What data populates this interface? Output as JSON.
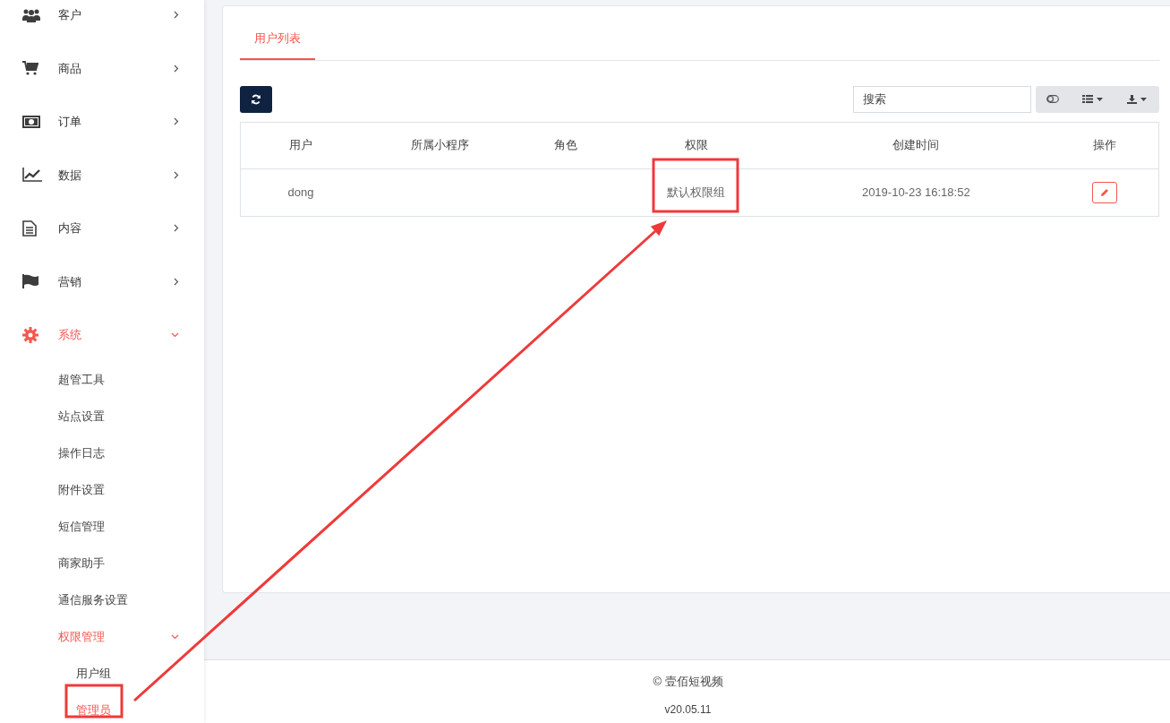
{
  "sidebar": {
    "items": [
      {
        "label": "客户",
        "expanded": false
      },
      {
        "label": "商品",
        "expanded": false
      },
      {
        "label": "订单",
        "expanded": false
      },
      {
        "label": "数据",
        "expanded": false
      },
      {
        "label": "内容",
        "expanded": false
      },
      {
        "label": "营销",
        "expanded": false
      },
      {
        "label": "系统",
        "expanded": true,
        "children": [
          {
            "label": "超管工具",
            "expanded": false
          },
          {
            "label": "站点设置",
            "expanded": false
          },
          {
            "label": "操作日志",
            "expanded": false
          },
          {
            "label": "附件设置",
            "expanded": false
          },
          {
            "label": "短信管理",
            "expanded": false
          },
          {
            "label": "商家助手",
            "expanded": false
          },
          {
            "label": "通信服务设置",
            "expanded": false
          },
          {
            "label": "权限管理",
            "expanded": true,
            "children": [
              {
                "label": "用户组",
                "selected": false
              },
              {
                "label": "管理员",
                "selected": true
              }
            ]
          }
        ]
      }
    ]
  },
  "tabs": [
    {
      "label": "用户列表",
      "selected": true
    }
  ],
  "search": {
    "placeholder": "搜索"
  },
  "table": {
    "columns": [
      "用户",
      "所属小程序",
      "角色",
      "权限",
      "创建时间",
      "操作"
    ],
    "rows": [
      {
        "cells": [
          "dong",
          "",
          "",
          "默认权限组",
          "2019-10-23 16:18:52"
        ]
      }
    ]
  },
  "footer": {
    "copyright": "© 壹佰短视频",
    "version": "v20.05.11"
  }
}
